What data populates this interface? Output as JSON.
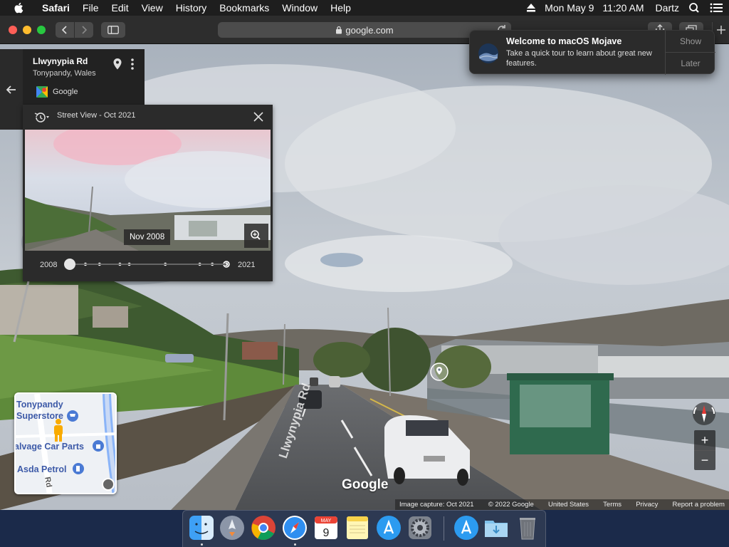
{
  "menubar": {
    "app_name": "Safari",
    "menus": [
      "File",
      "Edit",
      "View",
      "History",
      "Bookmarks",
      "Window",
      "Help"
    ],
    "date": "Mon May 9",
    "time": "11:20 AM",
    "user": "Dartz",
    "icons": [
      "apple-icon",
      "eject-icon",
      "search-icon",
      "list-icon"
    ]
  },
  "toolbar": {
    "url": "google.com",
    "icons": [
      "back-icon",
      "forward-icon",
      "sidebar-icon",
      "lock-icon",
      "reload-icon",
      "share-icon",
      "tabs-icon",
      "plus-icon"
    ]
  },
  "place": {
    "title": "Llwynypia Rd",
    "subtitle": "Tonypandy, Wales",
    "source": "Google"
  },
  "time_travel": {
    "title": "Street View - Oct 2021",
    "preview_date": "Nov 2008",
    "year_start": "2008",
    "year_end": "2021",
    "selected_index": 0,
    "capture_count": 10
  },
  "minimap": {
    "labels": [
      "Tonypandy",
      "Superstore",
      "alvage Car Parts",
      "Asda Petrol"
    ],
    "road_label": "Rd"
  },
  "street": {
    "road_label": "Llwynypia Rd",
    "wordmark": "Google"
  },
  "footer": {
    "capture": "Image capture: Oct 2021",
    "copyright": "© 2022 Google",
    "region": "United States",
    "terms": "Terms",
    "privacy": "Privacy",
    "report": "Report a problem"
  },
  "notification": {
    "title": "Welcome to macOS Mojave",
    "body": "Take a quick tour to learn about great new features.",
    "show_label": "Show",
    "later_label": "Later"
  },
  "controls": {
    "zoom_in": "+",
    "zoom_out": "−"
  },
  "dock": {
    "apps": [
      "Finder",
      "Launchpad",
      "Chrome",
      "Safari",
      "Calendar",
      "Notes",
      "App Store",
      "System Preferences",
      "Downloads App Store",
      "Downloads",
      "Trash"
    ],
    "calendar_month": "MAY",
    "calendar_day": "9"
  }
}
